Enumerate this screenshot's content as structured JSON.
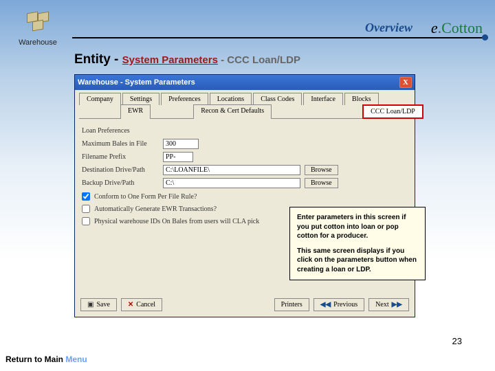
{
  "header": {
    "logo_label": "Warehouse",
    "overview": "Overview",
    "brand_e": "e",
    "brand_dot": ".",
    "brand_cotton": "Cotton"
  },
  "crumb": {
    "entity": "Entity",
    "sep1": " - ",
    "sys": "System Parameters",
    "sep2": " - ",
    "tail": "CCC Loan/LDP"
  },
  "window": {
    "title": "Warehouse - System Parameters",
    "close": "X",
    "tabs_row1": [
      "Company",
      "Settings",
      "Preferences",
      "Locations",
      "Class Codes",
      "Interface",
      "Blocks"
    ],
    "tabs_row2": {
      "left": "EWR",
      "mid": "Recon & Cert Defaults",
      "sel": "CCC Loan/LDP"
    },
    "group": "Loan Preferences",
    "fields": {
      "max_bales_label": "Maximum Bales in File",
      "max_bales_value": "300",
      "prefix_label": "Filename Prefix",
      "prefix_value": "PP-",
      "dest_label": "Destination Drive/Path",
      "dest_value": "C:\\LOANFILE\\",
      "backup_label": "Backup Drive/Path",
      "backup_value": "C:\\",
      "browse": "Browse",
      "browse2": "Browse"
    },
    "checks": {
      "c1": "Conform to One Form Per File Rule?",
      "c2": "Automatically Generate EWR Transactions?",
      "c3": "Physical warehouse IDs On Bales from users will CLA pick"
    },
    "callout": {
      "p1": "Enter parameters in this screen if you put cotton into loan or pop cotton for a producer.",
      "p2": "This same screen displays if you click on the parameters button when creating a loan or LDP."
    },
    "buttons": {
      "save": "Save",
      "cancel": "Cancel",
      "printers": "Printers",
      "prev": "Previous",
      "next": "Next"
    }
  },
  "footer": {
    "page": "23",
    "return": "Return to Main",
    "return_link": "Menu"
  }
}
